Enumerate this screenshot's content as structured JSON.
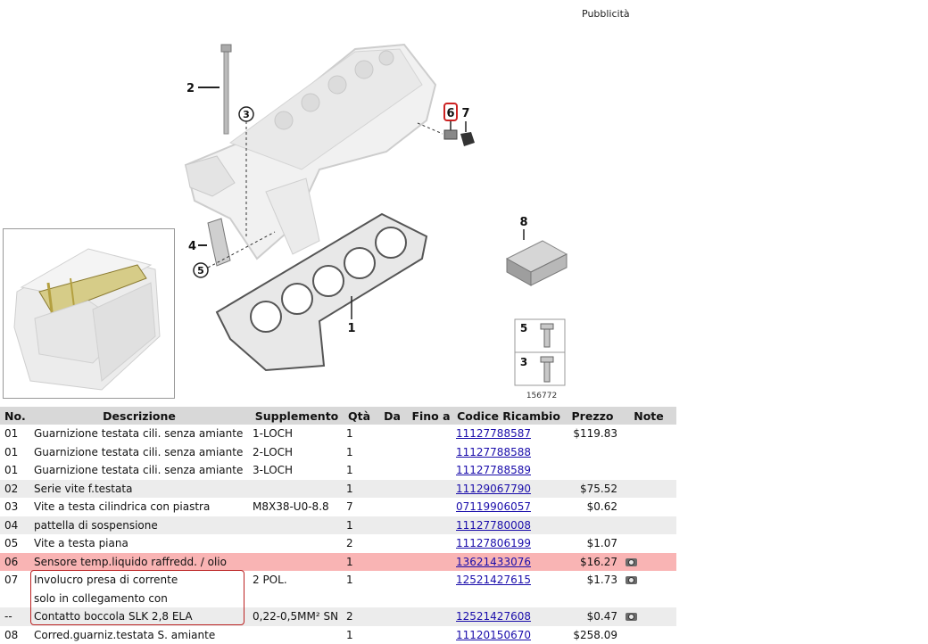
{
  "ad_label": "Pubblicità",
  "diagram": {
    "callouts": [
      "1",
      "2",
      "3",
      "4",
      "5",
      "6",
      "7",
      "8"
    ],
    "inset_labels": [
      "5",
      "3"
    ],
    "image_number": "156772"
  },
  "table": {
    "headers": {
      "no": "No.",
      "desc": "Descrizione",
      "supp": "Supplemento",
      "qty": "Qtà",
      "from": "Da",
      "until": "Fino a",
      "code": "Codice Ricambio",
      "price": "Prezzo",
      "notes": "Note"
    },
    "rows": [
      {
        "no": "01",
        "desc": "Guarnizione testata cili. senza amiante",
        "supp": "1-LOCH",
        "qty": "1",
        "code": "11127788587",
        "price": "$119.83"
      },
      {
        "no": "01",
        "desc": "Guarnizione testata cili. senza amiante",
        "supp": "2-LOCH",
        "qty": "1",
        "code": "11127788588",
        "price": ""
      },
      {
        "no": "01",
        "desc": "Guarnizione testata cili. senza amiante",
        "supp": "3-LOCH",
        "qty": "1",
        "code": "11127788589",
        "price": ""
      },
      {
        "no": "02",
        "desc": "Serie vite f.testata",
        "supp": "",
        "qty": "1",
        "code": "11129067790",
        "price": "$75.52"
      },
      {
        "no": "03",
        "desc": "Vite a testa cilindrica con piastra",
        "supp": "M8X38-U0-8.8",
        "qty": "7",
        "code": "07119906057",
        "price": "$0.62"
      },
      {
        "no": "04",
        "desc": "pattella di sospensione",
        "supp": "",
        "qty": "1",
        "code": "11127780008",
        "price": ""
      },
      {
        "no": "05",
        "desc": "Vite a testa piana",
        "supp": "",
        "qty": "2",
        "code": "11127806199",
        "price": "$1.07"
      },
      {
        "no": "06",
        "desc": "Sensore temp.liquido raffredd. / olio",
        "supp": "",
        "qty": "1",
        "code": "13621433076",
        "price": "$16.27"
      },
      {
        "no": "07",
        "desc_lines": [
          "Involucro presa di corrente",
          "solo in collegamento con"
        ],
        "supp": "2 POL.",
        "qty": "1",
        "code": "12521427615",
        "price": "$1.73"
      },
      {
        "no": "--",
        "desc": "Contatto boccola SLK 2,8 ELA",
        "supp": "0,22-0,5MM² SN",
        "qty": "2",
        "code": "12521427608",
        "price": "$0.47"
      },
      {
        "no": "08",
        "desc": "Corred.guarniz.testata S. amiante",
        "supp": "",
        "qty": "1",
        "code": "11120150670",
        "price": "$258.09"
      }
    ]
  },
  "colors": {
    "highlight_row": "#f9b4b4",
    "stripe_row": "#ececec",
    "header_bg": "#d8d8d8",
    "link": "#1a0dab",
    "callout_box": "#cc2222"
  },
  "icons": {
    "note": "camera-icon"
  }
}
